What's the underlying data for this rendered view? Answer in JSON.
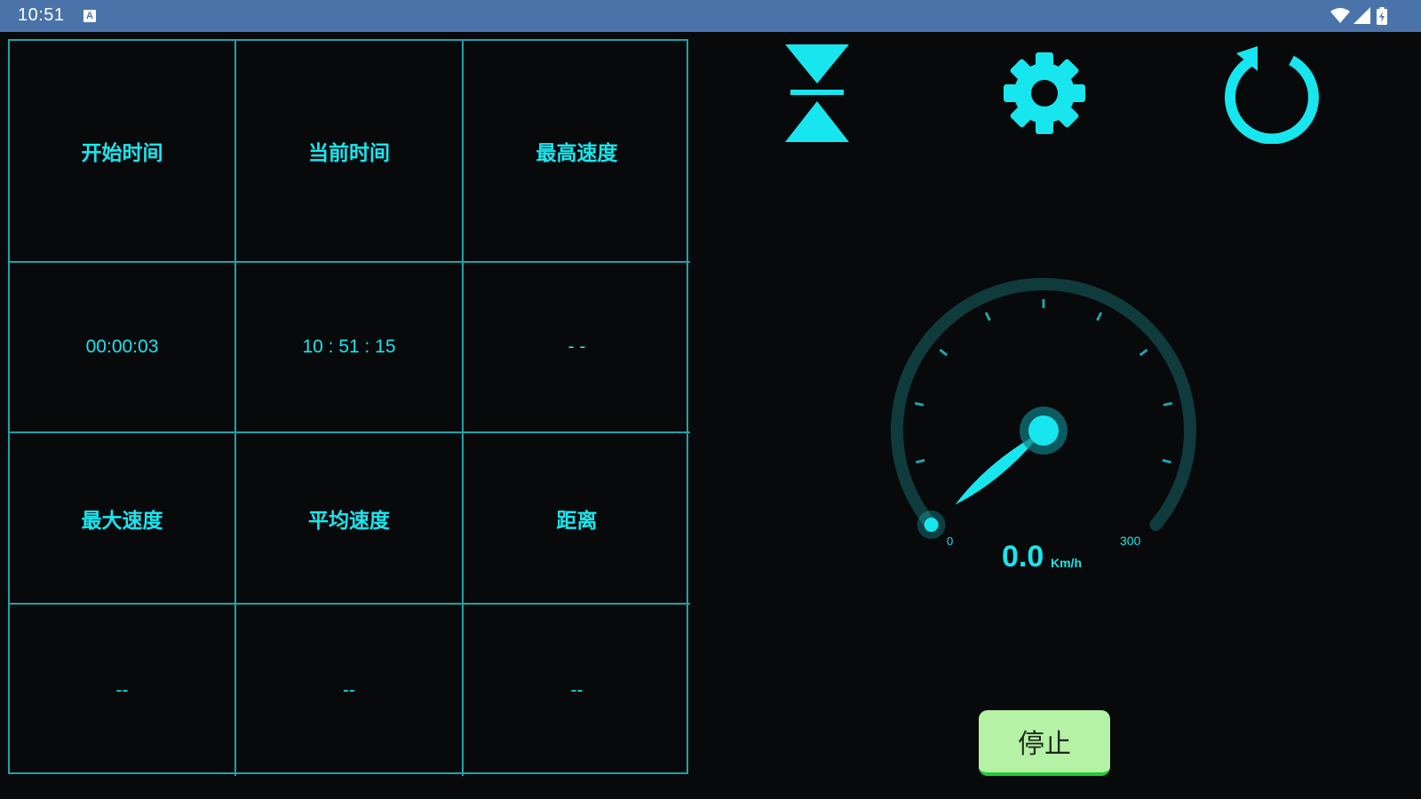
{
  "status_bar": {
    "time": "10:51",
    "notification_icon": "A",
    "icons": [
      "wifi-icon",
      "signal-icon",
      "battery-charging-icon"
    ]
  },
  "table": {
    "headers_top": [
      "开始时间",
      "当前时间",
      "最高速度"
    ],
    "values_top": [
      "00:00:03",
      "10 : 51 : 15",
      "- -"
    ],
    "headers_bottom": [
      "最大速度",
      "平均速度",
      "距离"
    ],
    "values_bottom": [
      "--",
      "--",
      "--"
    ]
  },
  "toolbar": {
    "icons": [
      "hourglass-icon",
      "gear-icon",
      "refresh-icon"
    ]
  },
  "gauge": {
    "speed": "0.0",
    "unit": "Km/h",
    "min_label": "0",
    "max_label": "300",
    "min": 0,
    "max": 300,
    "value": 0
  },
  "colors": {
    "accent": "#18e6ee",
    "grid_line": "#1fa3a8",
    "background": "#08090b",
    "status_bar": "#4a73aa",
    "stop_button": "#b6f2a6",
    "stop_button_border": "#26c93a",
    "gauge_track": "#0f3b3d"
  },
  "stop_button": {
    "label": "停止"
  }
}
